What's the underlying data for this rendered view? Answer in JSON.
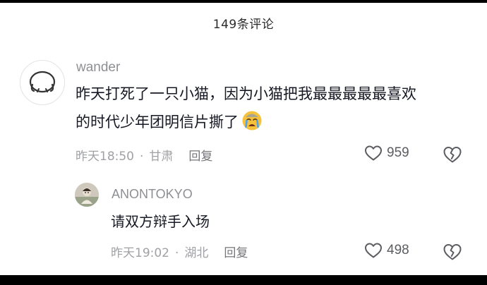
{
  "header": {
    "title": "149条评论"
  },
  "comments": [
    {
      "username": "wander",
      "text_lines": [
        "昨天打死了一只小猫，因为小猫把我最最最最最喜欢",
        "的时代少年团明信片撕了"
      ],
      "emoji": "crying-face",
      "time": "昨天18:50",
      "separator": "·",
      "location": "甘肃",
      "reply_label": "回复",
      "likes": "959"
    }
  ],
  "replies": [
    {
      "username": "ANONTOKYO",
      "text": "请双方辩手入场",
      "time": "昨天19:02",
      "separator": "·",
      "location": "湖北",
      "reply_label": "回复",
      "likes": "498"
    }
  ],
  "colors": {
    "text": "#161823",
    "secondary": "#8e8f93",
    "meta": "#a0a1a5",
    "emoji": "#f7c23b"
  }
}
